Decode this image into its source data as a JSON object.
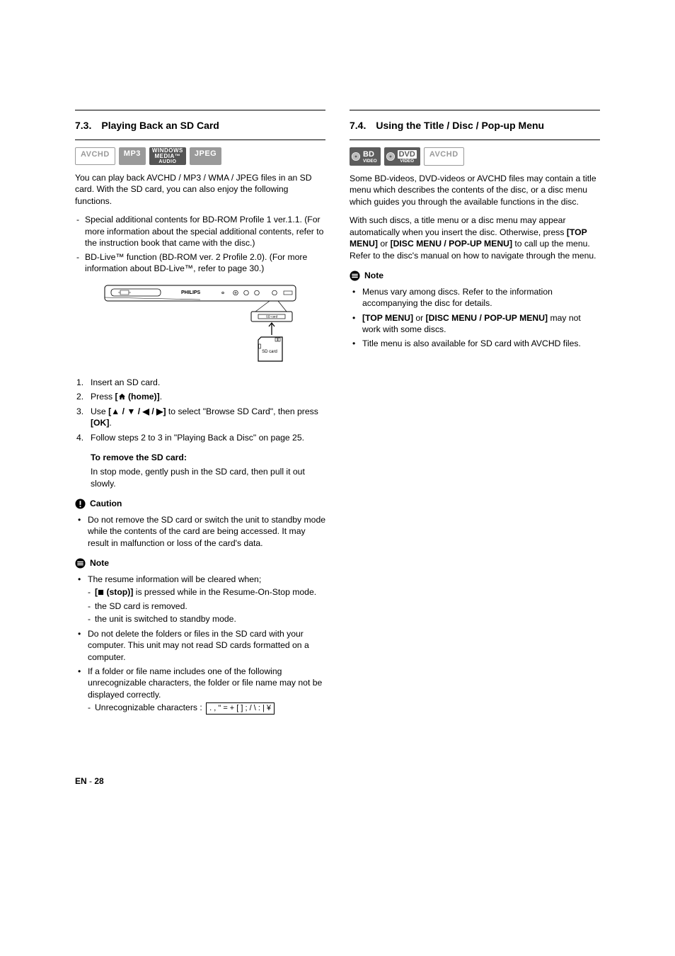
{
  "left": {
    "title": "7.3. Playing Back an SD Card",
    "badges": {
      "avchd": "AVCHD",
      "mp3": "MP3",
      "wma1": "WINDOWS",
      "wma2": "MEDIA™",
      "wma3": "AUDIO",
      "jpeg": "JPEG"
    },
    "intro": "You can play back AVCHD / MP3 / WMA / JPEG files in an SD card. With the SD card, you can also enjoy the following functions.",
    "feat1": "Special additional contents for BD-ROM Profile 1 ver.1.1. (For more information about the special additional contents, refer to the instruction book that came with the disc.)",
    "feat2": "BD-Live™ function (BD-ROM ver. 2 Profile 2.0). (For more information about BD-Live™, refer to page 30.)",
    "fig_brand": "PHILIPS",
    "fig_sdslot": "SD card",
    "fig_sdlabel": "SD card",
    "step1": "Insert an SD card.",
    "step2_a": "Press ",
    "step2_b": "[",
    "step2_c": " (home)]",
    "step2_d": ".",
    "step3_a": "Use ",
    "step3_b": "[▲ / ▼ / ◀ / ▶]",
    "step3_c": " to select \"Browse SD Card\", then press ",
    "step3_d": "[OK]",
    "step3_e": ".",
    "step4": "Follow steps 2 to 3 in \"Playing Back a Disc\" on page 25.",
    "remove_h": "To remove the SD card:",
    "remove_b": "In stop mode, gently push in the SD card, then pull it out slowly.",
    "caution_h": "Caution",
    "caution1": "Do not remove the SD card or switch the unit to standby mode while the contents of the card are being accessed. It may result in malfunction or loss of the card's data.",
    "note_h": "Note",
    "note1": "The resume information will be cleared when;",
    "note1a_a": "[",
    "note1a_b": " (stop)]",
    "note1a_c": " is pressed while in the Resume-On-Stop mode.",
    "note1b": "the SD card is removed.",
    "note1c": "the unit is switched to standby mode.",
    "note2": "Do not delete the folders or files in the SD card with your computer. This unit may not read SD cards formatted on a computer.",
    "note3": "If a folder or file name includes one of the following unrecognizable characters, the folder or file name may not be displayed correctly.",
    "note3a": "Unrecognizable characters : ",
    "note3chars": ". , \" = + [ ] ; / \\ : | ¥"
  },
  "right": {
    "title": "7.4. Using the Title / Disc / Pop-up Menu",
    "badges": {
      "bd": "BD",
      "bd_sub": "VIDEO",
      "dvd": "DVD",
      "dvd_sub": "VIDEO",
      "avchd": "AVCHD"
    },
    "p1": "Some BD-videos, DVD-videos or AVCHD files may contain a title menu which describes the contents of the disc, or a disc menu which guides you through the available functions in the disc.",
    "p2_a": "With such discs, a title menu or a disc menu may appear automatically when you insert the disc. Otherwise, press ",
    "p2_b": "[TOP MENU]",
    "p2_c": " or ",
    "p2_d": "[DISC MENU / POP-UP MENU]",
    "p2_e": " to call up the menu. Refer to the disc's manual on how to navigate through the menu.",
    "note_h": "Note",
    "note1": "Menus vary among discs. Refer to the information accompanying the disc for details.",
    "note2_a": "[TOP MENU]",
    "note2_b": " or ",
    "note2_c": "[DISC MENU / POP-UP MENU]",
    "note2_d": " may not work with some discs.",
    "note3": "Title menu is also available for SD card with AVCHD files."
  },
  "footer": {
    "en": "EN",
    "sep": " - ",
    "page": "28"
  }
}
